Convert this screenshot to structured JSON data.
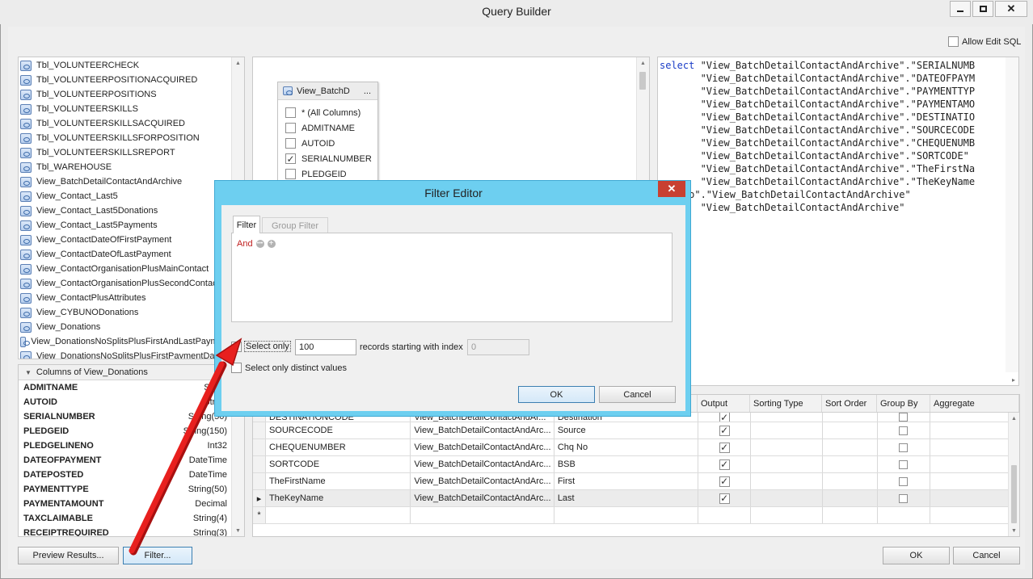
{
  "window": {
    "title": "Query Builder"
  },
  "allow_edit_sql": {
    "label": "Allow Edit SQL",
    "checked": false
  },
  "object_list": [
    "Tbl_VOLUNTEERCHECK",
    "Tbl_VOLUNTEERPOSITIONACQUIRED",
    "Tbl_VOLUNTEERPOSITIONS",
    "Tbl_VOLUNTEERSKILLS",
    "Tbl_VOLUNTEERSKILLSACQUIRED",
    "Tbl_VOLUNTEERSKILLSFORPOSITION",
    "Tbl_VOLUNTEERSKILLSREPORT",
    "Tbl_WAREHOUSE",
    "View_BatchDetailContactAndArchive",
    "View_Contact_Last5",
    "View_Contact_Last5Donations",
    "View_Contact_Last5Payments",
    "View_ContactDateOfFirstPayment",
    "View_ContactDateOfLastPayment",
    "View_ContactOrganisationPlusMainContact",
    "View_ContactOrganisationPlusSecondContact",
    "View_ContactPlusAttributes",
    "View_CYBUNODonations",
    "View_Donations",
    "View_DonationsNoSplitsPlusFirstAndLastPayment",
    "View_DonationsNoSplitsPlusFirstPaymentDate"
  ],
  "columns_panel": {
    "header": "Columns of View_Donations",
    "rows": [
      {
        "name": "ADMITNAME",
        "type": "String"
      },
      {
        "name": "AUTOID",
        "type": "String"
      },
      {
        "name": "SERIALNUMBER",
        "type": "String(50)"
      },
      {
        "name": "PLEDGEID",
        "type": "String(150)"
      },
      {
        "name": "PLEDGELINENO",
        "type": "Int32"
      },
      {
        "name": "DATEOFPAYMENT",
        "type": "DateTime"
      },
      {
        "name": "DATEPOSTED",
        "type": "DateTime"
      },
      {
        "name": "PAYMENTTYPE",
        "type": "String(50)"
      },
      {
        "name": "PAYMENTAMOUNT",
        "type": "Decimal"
      },
      {
        "name": "TAXCLAIMABLE",
        "type": "String(4)"
      },
      {
        "name": "RECEIPTREQUIRED",
        "type": "String(3)"
      }
    ]
  },
  "table_box": {
    "title": "View_BatchD",
    "menu": "...",
    "fields": [
      {
        "label": "* (All Columns)",
        "checked": false
      },
      {
        "label": "ADMITNAME",
        "checked": false
      },
      {
        "label": "AUTOID",
        "checked": false
      },
      {
        "label": "SERIALNUMBER",
        "checked": true
      },
      {
        "label": "PLEDGEID",
        "checked": false
      }
    ]
  },
  "sql_lines": [
    {
      "kw": "select",
      "text": " \"View_BatchDetailContactAndArchive\".\"SERIALNUMB"
    },
    {
      "kw": "",
      "text": "       \"View_BatchDetailContactAndArchive\".\"DATEOFPAYM"
    },
    {
      "kw": "",
      "text": "       \"View_BatchDetailContactAndArchive\".\"PAYMENTTYP"
    },
    {
      "kw": "",
      "text": "       \"View_BatchDetailContactAndArchive\".\"PAYMENTAMO"
    },
    {
      "kw": "",
      "text": "       \"View_BatchDetailContactAndArchive\".\"DESTINATIO"
    },
    {
      "kw": "",
      "text": "       \"View_BatchDetailContactAndArchive\".\"SOURCECODE"
    },
    {
      "kw": "",
      "text": "       \"View_BatchDetailContactAndArchive\".\"CHEQUENUMB"
    },
    {
      "kw": "",
      "text": "       \"View_BatchDetailContactAndArchive\".\"SORTCODE\""
    },
    {
      "kw": "",
      "text": "       \"View_BatchDetailContactAndArchive\".\"TheFirstNa"
    },
    {
      "kw": "",
      "text": "       \"View_BatchDetailContactAndArchive\".\"TheKeyName"
    },
    {
      "kw": "m",
      "text": " \"dbo\".\"View_BatchDetailContactAndArchive\""
    },
    {
      "kw": "",
      "text": "       \"View_BatchDetailContactAndArchive\""
    }
  ],
  "grid": {
    "headers": [
      "Output",
      "Sorting Type",
      "Sort Order",
      "Group By",
      "Aggregate"
    ],
    "rows": [
      {
        "col": "DESTINATIONCODE",
        "table": "View_BatchDetailContactAndAr...",
        "alias": "Destination",
        "output": true,
        "group": false
      },
      {
        "col": "SOURCECODE",
        "table": "View_BatchDetailContactAndArc...",
        "alias": "Source",
        "output": true,
        "group": false
      },
      {
        "col": "CHEQUENUMBER",
        "table": "View_BatchDetailContactAndArc...",
        "alias": "Chq No",
        "output": true,
        "group": false
      },
      {
        "col": "SORTCODE",
        "table": "View_BatchDetailContactAndArc...",
        "alias": "BSB",
        "output": true,
        "group": false
      },
      {
        "col": "TheFirstName",
        "table": "View_BatchDetailContactAndArc...",
        "alias": "First",
        "output": true,
        "group": false
      },
      {
        "col": "TheKeyName",
        "table": "View_BatchDetailContactAndArc...",
        "alias": "Last",
        "output": true,
        "group": false
      }
    ],
    "current_marker": "▸",
    "new_marker": "*"
  },
  "buttons": {
    "preview": "Preview Results...",
    "filter": "Filter...",
    "ok": "OK",
    "cancel": "Cancel"
  },
  "filter_editor": {
    "title": "Filter Editor",
    "close": "✕",
    "tabs": [
      "Filter",
      "Group Filter"
    ],
    "group_op": "And",
    "select_only_label": "Select only",
    "select_only_checked": true,
    "records_value": "100",
    "records_label": "records starting with index",
    "index_value": "0",
    "distinct_label": "Select only distinct values",
    "distinct_checked": false,
    "ok": "OK",
    "cancel": "Cancel"
  },
  "colors": {
    "dialog_frame": "#6dcff0",
    "close_red": "#c84031",
    "arrow": "#e8201e",
    "sql_keyword": "#1a3cc7"
  }
}
